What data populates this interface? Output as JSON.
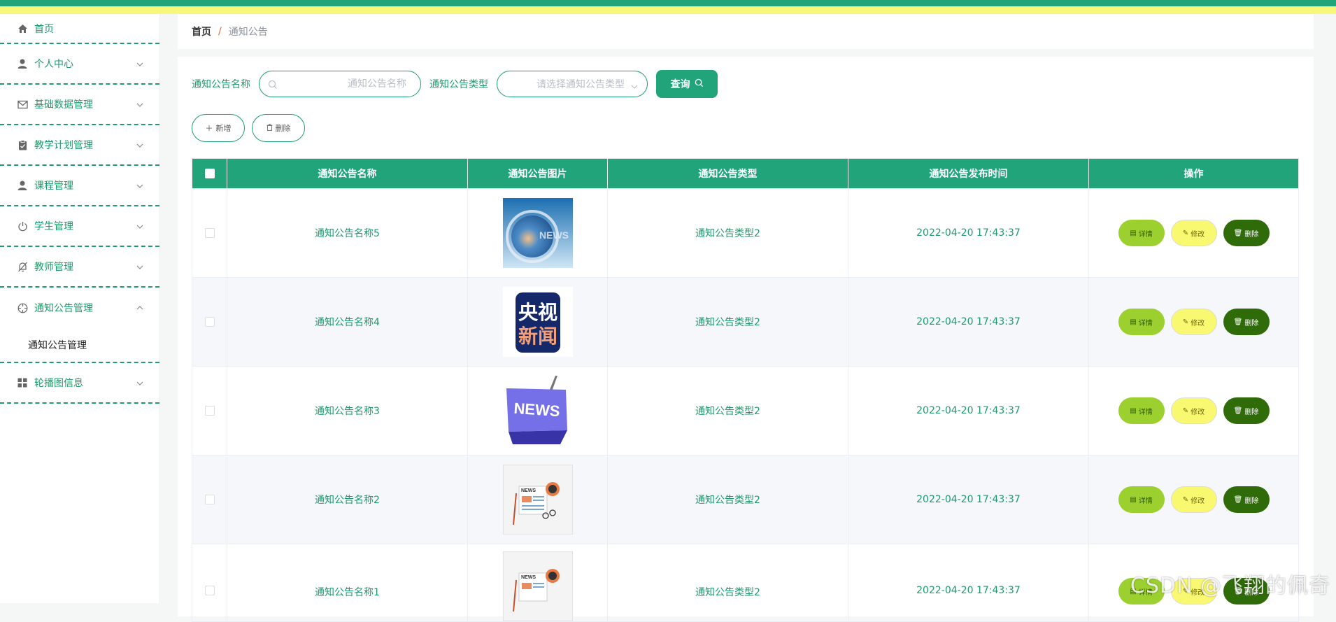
{
  "colors": {
    "primary": "#21a47a",
    "topbar_yellow": "#f7f77a",
    "detail": "#9bd02e",
    "edit": "#f9f871",
    "delete": "#2f6b08",
    "breadcrumb_sep": "#f0623b"
  },
  "sidebar": {
    "items": [
      {
        "label": "首页",
        "icon": "home-icon"
      },
      {
        "label": "个人中心",
        "icon": "user-icon"
      },
      {
        "label": "基础数据管理",
        "icon": "mail-icon"
      },
      {
        "label": "教学计划管理",
        "icon": "clipboard-icon"
      },
      {
        "label": "课程管理",
        "icon": "user-icon"
      },
      {
        "label": "学生管理",
        "icon": "power-icon"
      },
      {
        "label": "教师管理",
        "icon": "bell-off-icon"
      },
      {
        "label": "通知公告管理",
        "icon": "crosshair-icon",
        "expanded": true
      },
      {
        "label": "轮播图信息",
        "icon": "grid-icon"
      }
    ],
    "submenu": {
      "label": "通知公告管理"
    }
  },
  "breadcrumb": {
    "home": "首页",
    "separator": "/",
    "current": "通知公告"
  },
  "search": {
    "name_label": "通知公告名称",
    "name_placeholder": "通知公告名称",
    "type_label": "通知公告类型",
    "type_placeholder": "请选择通知公告类型",
    "query_button": "查询"
  },
  "actions": {
    "add": "新增",
    "delete": "删除"
  },
  "table": {
    "headers": [
      "通知公告名称",
      "通知公告图片",
      "通知公告类型",
      "通知公告发布时间",
      "操作"
    ],
    "rows": [
      {
        "name": "通知公告名称5",
        "image": "news-globe-image",
        "type": "通知公告类型2",
        "time": "2022-04-20 17:43:37"
      },
      {
        "name": "通知公告名称4",
        "image": "cctv-news-logo-image",
        "type": "通知公告类型2",
        "time": "2022-04-20 17:43:37"
      },
      {
        "name": "通知公告名称3",
        "image": "news-key-image",
        "type": "通知公告类型2",
        "time": "2022-04-20 17:43:37"
      },
      {
        "name": "通知公告名称2",
        "image": "newspaper-illustration-image",
        "type": "通知公告类型2",
        "time": "2022-04-20 17:43:37"
      },
      {
        "name": "通知公告名称1",
        "image": "newspaper-illustration-image",
        "type": "通知公告类型2",
        "time": "2022-04-20 17:43:37"
      }
    ],
    "row_actions": {
      "detail": "详情",
      "edit": "修改",
      "delete": "删除"
    }
  },
  "cctv_logo_text": "央视新闻",
  "news_key_text": "NEWS",
  "watermark": "CSDN @飞翔的佩奇"
}
